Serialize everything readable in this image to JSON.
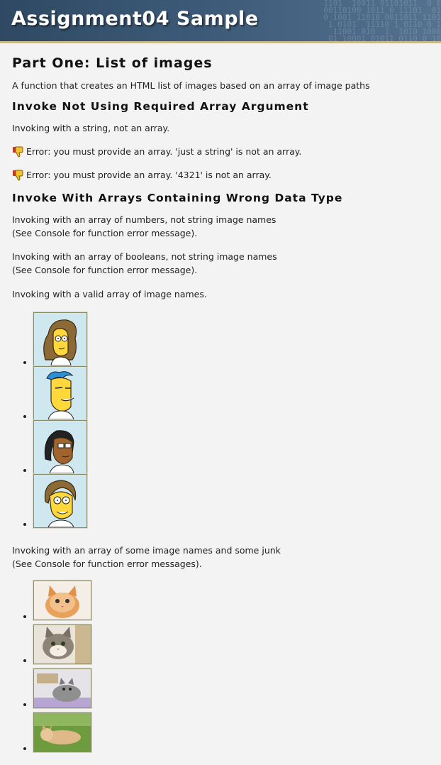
{
  "banner": {
    "title": "Assignment04 Sample",
    "binary_pattern": "1101  10011 01101011  0 0\n00110100 1011 0 11101  01\n 0 1001 11010 0011011 1101\n1 0101  11110 1 0110 0 1\n 11001 010  1  1010 1000\n01 10001 01011 0110 0 10"
  },
  "part_one": {
    "title": "Part One: List of images",
    "description": "A function that creates an HTML list of images based on an array of image paths"
  },
  "section_not_array": {
    "heading": "Invoke Not Using Required Array Argument",
    "intro": "Invoking with a string, not an array.",
    "error_icon": "thumbs-down-icon",
    "errors": [
      "Error: you must provide an array. 'just a string' is not an array.",
      "Error: you must provide an array. '4321' is not an array."
    ]
  },
  "section_wrong_type": {
    "heading": "Invoke With Arrays Containing Wrong Data Type",
    "numbers_line1": "Invoking with an array of numbers, not string image names",
    "numbers_line2": "(See Console for function error message).",
    "booleans_line1": "Invoking with an array of booleans, not string image names",
    "booleans_line2": "(See Console for function error message).",
    "valid_intro": "Invoking with a valid array of image names.",
    "simpsons_images": [
      "cartoon-woman-brown-hair",
      "cartoon-man-blue-hair",
      "cartoon-woman-glasses",
      "cartoon-man-brown-hair"
    ],
    "junk_line1": "Invoking with an array of some image names and some junk",
    "junk_line2": "(See Console for function error messages).",
    "cat_images": [
      "orange-kitten",
      "tabby-cat-peeking",
      "cat-in-basket",
      "cat-lying-in-grass"
    ]
  }
}
